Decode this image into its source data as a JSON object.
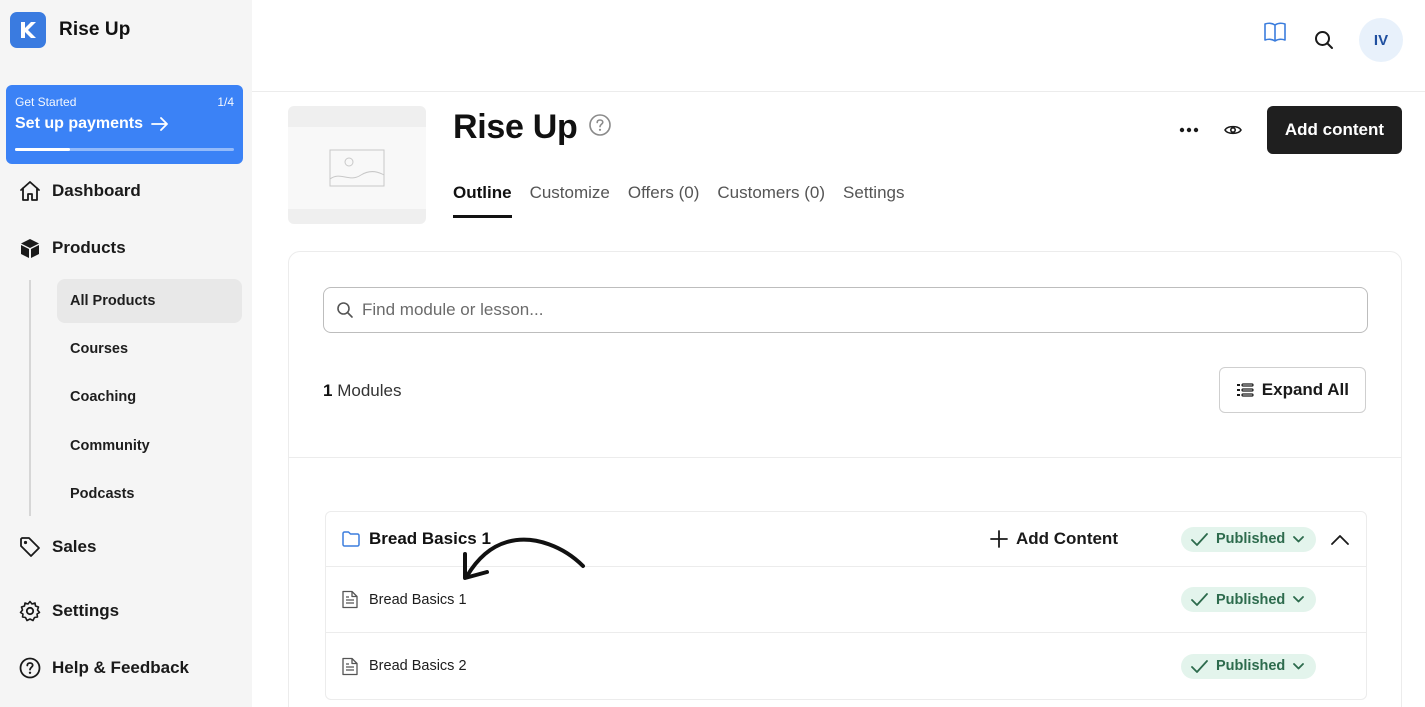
{
  "brand": {
    "name": "Rise Up"
  },
  "get_started": {
    "label": "Get Started",
    "step": "1/4",
    "title": "Set up payments",
    "progress": 0.25
  },
  "nav": {
    "dashboard": "Dashboard",
    "products": "Products",
    "sub_items": [
      "All Products",
      "Courses",
      "Coaching",
      "Community",
      "Podcasts"
    ],
    "sales": "Sales",
    "settings": "Settings",
    "help": "Help & Feedback"
  },
  "topbar": {
    "avatar_initials": "IV"
  },
  "product": {
    "title": "Rise Up",
    "tabs": [
      "Outline",
      "Customize",
      "Offers (0)",
      "Customers (0)",
      "Settings"
    ],
    "add_content_label": "Add content"
  },
  "outline": {
    "search_placeholder": "Find module or lesson...",
    "modules_count": "1",
    "modules_label": "Modules",
    "expand_all_label": "Expand All"
  },
  "module": {
    "title": "Bread Basics 1",
    "add_content_label": "Add Content",
    "status": "Published",
    "lessons": [
      {
        "title": "Bread Basics 1",
        "status": "Published"
      },
      {
        "title": "Bread Basics 2",
        "status": "Published"
      }
    ]
  },
  "colors": {
    "accent": "#3b82f6",
    "published_bg": "#e3f4ec",
    "published_text": "#2d6b4d"
  }
}
